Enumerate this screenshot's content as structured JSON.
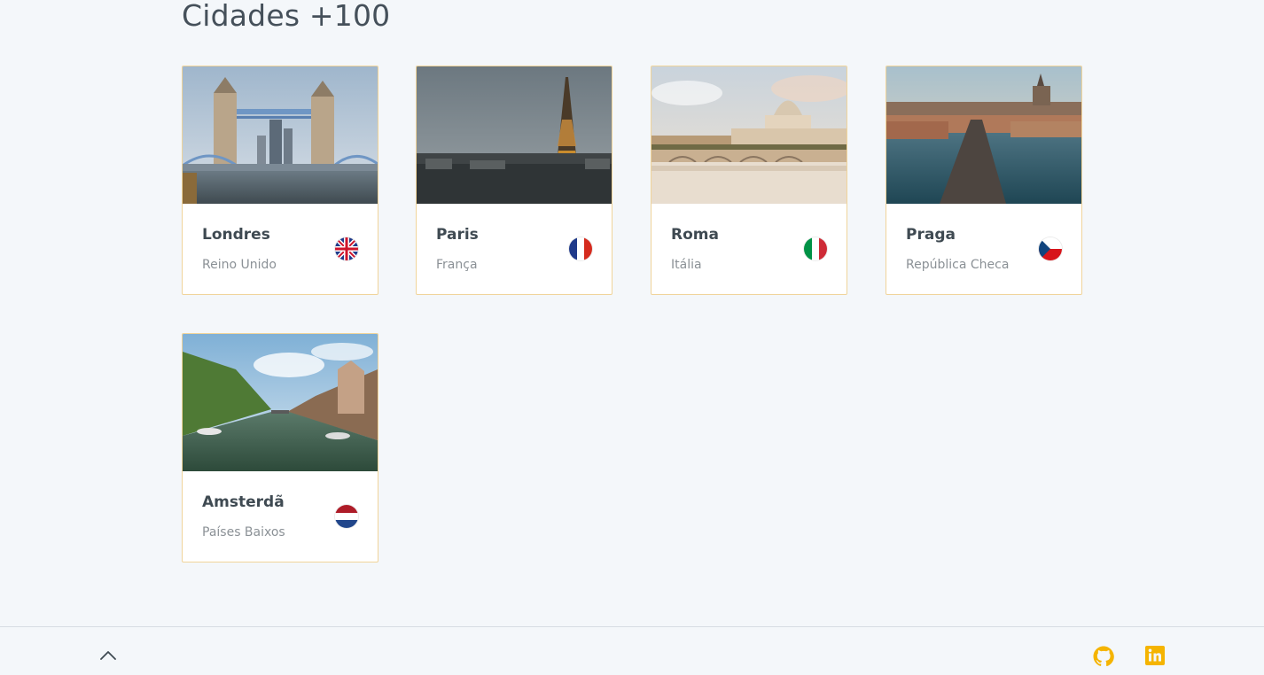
{
  "page": {
    "title": "Cidades +100"
  },
  "cities": [
    {
      "name": "Londres",
      "country": "Reino Unido",
      "flag_icon": "uk-flag-icon"
    },
    {
      "name": "Paris",
      "country": "França",
      "flag_icon": "france-flag-icon"
    },
    {
      "name": "Roma",
      "country": "Itália",
      "flag_icon": "italy-flag-icon"
    },
    {
      "name": "Praga",
      "country": "República Checa",
      "flag_icon": "czech-flag-icon"
    },
    {
      "name": "Amsterdã",
      "country": "Países Baixos",
      "flag_icon": "netherlands-flag-icon"
    }
  ],
  "footer": {
    "scroll_top_icon": "chevron-up-icon",
    "github_icon": "github-icon",
    "linkedin_icon": "linkedin-icon"
  },
  "colors": {
    "accent": "#f5b400",
    "card_border": "#f0d49a",
    "background": "#f4f7fa"
  }
}
